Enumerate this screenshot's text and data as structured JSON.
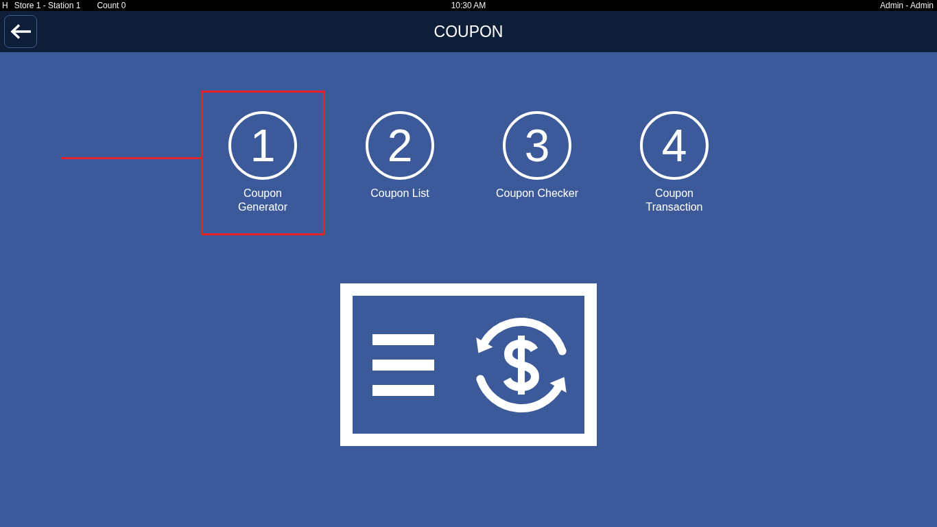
{
  "status_bar": {
    "mode": "H",
    "station": "Store 1 - Station 1",
    "count": "Count 0",
    "time": "10:30 AM",
    "user": "Admin - Admin"
  },
  "header": {
    "title": "COUPON"
  },
  "steps": [
    {
      "number": "1",
      "label": "Coupon Generator",
      "highlighted": true
    },
    {
      "number": "2",
      "label": "Coupon List",
      "highlighted": false
    },
    {
      "number": "3",
      "label": "Coupon Checker",
      "highlighted": false
    },
    {
      "number": "4",
      "label": "Coupon Transaction",
      "highlighted": false
    }
  ]
}
